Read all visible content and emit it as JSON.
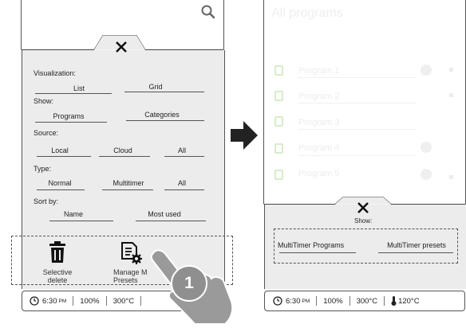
{
  "left_panel": {
    "sections": {
      "visualization": {
        "label": "Visualization:",
        "options": [
          "List",
          "Grid"
        ]
      },
      "show": {
        "label": "Show:",
        "options": [
          "Programs",
          "Categories"
        ]
      },
      "source": {
        "label": "Source:",
        "options": [
          "Local",
          "Cloud",
          "All"
        ]
      },
      "type": {
        "label": "Type:",
        "options": [
          "Normal",
          "Multitimer",
          "All"
        ]
      },
      "sort": {
        "label": "Sort by:",
        "options": [
          "Name",
          "Most used"
        ]
      }
    },
    "actions": {
      "selective_delete": "Selective\ndelete",
      "manage_presets": "Manage M\nPresets"
    },
    "status": {
      "time": "6:30",
      "ampm": "PM",
      "percent": "100%",
      "temp": "300°C"
    },
    "step_badge": "1"
  },
  "right_panel": {
    "title": "All programs",
    "programs": [
      "Program 1",
      "Program 2",
      "Program 3",
      "Program 4",
      "Program 5"
    ],
    "show": {
      "label": "Show:",
      "options": [
        "MultiTimer Programs",
        "MultiTimer presets"
      ]
    },
    "status": {
      "time": "6:30",
      "ampm": "PM",
      "percent": "100%",
      "temp": "300°C",
      "probe_temp": "120°C"
    }
  },
  "colors": {
    "panel_bg": "#ececec",
    "dash": "#555555",
    "hand": "#9a9a9a",
    "arrow": "#222222"
  },
  "icons": [
    "search-icon",
    "close-icon",
    "trash-icon",
    "manage-presets-icon",
    "clock-icon",
    "probe-icon",
    "arrow-right-icon",
    "hand-pointer-icon"
  ]
}
